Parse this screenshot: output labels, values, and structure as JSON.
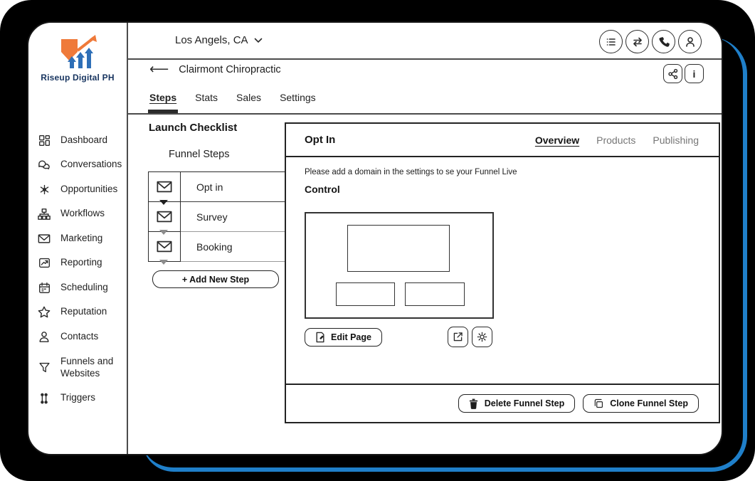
{
  "brand": {
    "name": "Riseup Digital PH"
  },
  "topbar": {
    "location": "Los Angels, CA",
    "icon_buttons": [
      "menu-list-icon",
      "transfer-icon",
      "phone-icon",
      "user-icon"
    ]
  },
  "subheader": {
    "account_name": "Clairmont Chiropractic",
    "icon_buttons": [
      "share-icon",
      "info-icon"
    ]
  },
  "glyphs": {
    "back_arrow": "⟵",
    "info": "i"
  },
  "nav_tabs": [
    {
      "label": "Steps",
      "active": true
    },
    {
      "label": "Stats",
      "active": false
    },
    {
      "label": "Sales",
      "active": false
    },
    {
      "label": "Settings",
      "active": false
    }
  ],
  "sidebar": {
    "items": [
      {
        "icon": "dashboard-icon",
        "label": "Dashboard"
      },
      {
        "icon": "conversations-icon",
        "label": "Conversations"
      },
      {
        "icon": "opportunities-icon",
        "label": "Opportunities"
      },
      {
        "icon": "workflows-icon",
        "label": "Workflows"
      },
      {
        "icon": "marketing-icon",
        "label": "Marketing"
      },
      {
        "icon": "reporting-icon",
        "label": "Reporting"
      },
      {
        "icon": "scheduling-icon",
        "label": "Scheduling"
      },
      {
        "icon": "reputation-icon",
        "label": "Reputation"
      },
      {
        "icon": "contacts-icon",
        "label": "Contacts"
      },
      {
        "icon": "funnels-icon",
        "label": "Funnels and Websites"
      },
      {
        "icon": "triggers-icon",
        "label": "Triggers"
      }
    ]
  },
  "checklist": {
    "title": "Launch Checklist",
    "subtitle": "Funnel Steps",
    "steps": [
      {
        "icon": "envelope-icon",
        "label": "Opt in"
      },
      {
        "icon": "envelope-icon",
        "label": "Survey"
      },
      {
        "icon": "envelope-icon",
        "label": "Booking"
      }
    ],
    "add_step_label": "+  Add New Step"
  },
  "panel": {
    "title": "Opt In",
    "tabs": [
      {
        "label": "Overview",
        "active": true
      },
      {
        "label": "Products",
        "active": false
      },
      {
        "label": "Publishing",
        "active": false
      }
    ],
    "notice": "Please add a domain in the settings to se your Funnel Live",
    "section_title": "Control",
    "edit_page_label": "Edit Page",
    "delete_label": "Delete Funnel Step",
    "clone_label": "Clone Funnel Step"
  },
  "colors": {
    "accent_blue": "#1f7fc9",
    "logo_orange": "#ef7a3a",
    "logo_blue": "#2e6fb7",
    "logo_navy": "#17345f"
  }
}
